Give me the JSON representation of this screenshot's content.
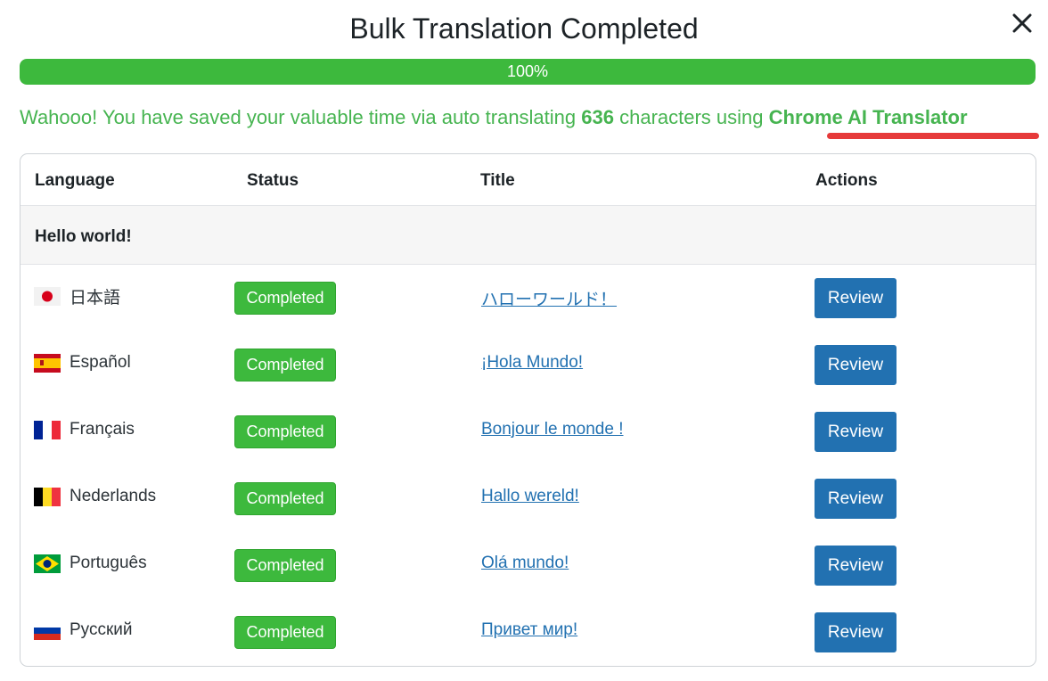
{
  "modal": {
    "title": "Bulk Translation Completed",
    "close_icon": "close-icon"
  },
  "progress": {
    "percent": 100,
    "label": "100%",
    "color": "#3db93d"
  },
  "summary": {
    "prefix": "Wahooo! You have saved your valuable time via auto translating ",
    "count": "636",
    "middle": " characters using ",
    "translator": "Chrome AI Translator",
    "highlight_color": "#e63a3a"
  },
  "table": {
    "headers": {
      "language": "Language",
      "status": "Status",
      "title": "Title",
      "actions": "Actions"
    },
    "group_title": "Hello world!",
    "rows": [
      {
        "flag": "flag-japan-icon",
        "language": "日本語",
        "status": "Completed",
        "title": "ハローワールド！",
        "action": "Review"
      },
      {
        "flag": "flag-spain-icon",
        "language": "Español",
        "status": "Completed",
        "title": "¡Hola Mundo!",
        "action": "Review"
      },
      {
        "flag": "flag-france-icon",
        "language": "Français",
        "status": "Completed",
        "title": "Bonjour le monde !",
        "action": "Review"
      },
      {
        "flag": "flag-belgium-icon",
        "language": "Nederlands",
        "status": "Completed",
        "title": "Hallo wereld!",
        "action": "Review"
      },
      {
        "flag": "flag-brazil-icon",
        "language": "Português",
        "status": "Completed",
        "title": "Olá mundo!",
        "action": "Review"
      },
      {
        "flag": "flag-russia-icon",
        "language": "Русский",
        "status": "Completed",
        "title": "Привет мир!",
        "action": "Review"
      }
    ]
  },
  "colors": {
    "success_green": "#3db93d",
    "primary_blue": "#2271b1",
    "link_blue": "#2271b1"
  }
}
